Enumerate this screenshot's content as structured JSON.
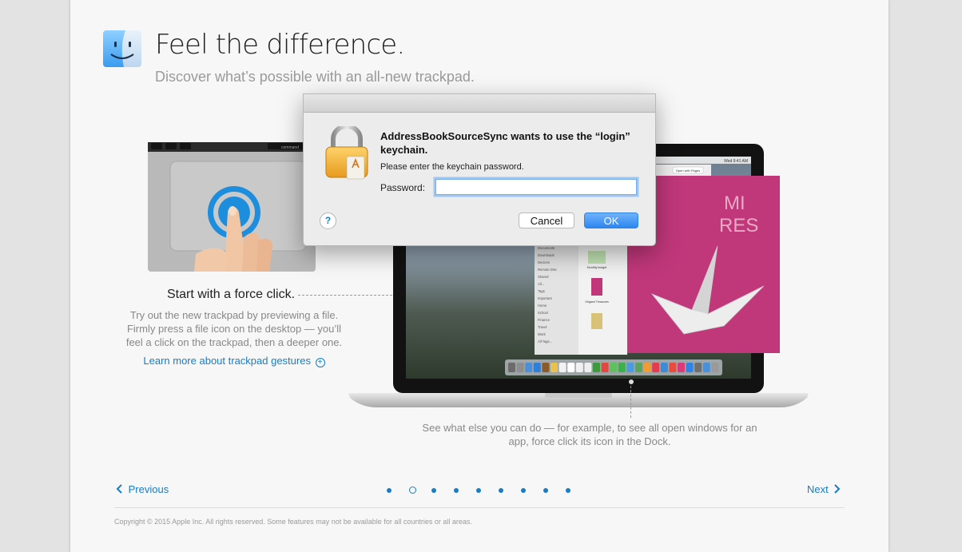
{
  "header": {
    "title": "Feel the difference.",
    "subtitle": "Discover what’s possible with an all-new trackpad.",
    "icon": "finder-icon"
  },
  "force_click": {
    "heading": "Start with a force click.",
    "description": "Try out the new trackpad by previewing a file. Firmly press a file icon on the desktop — you’ll feel a click on the trackpad, then a deeper one.",
    "link_label": "Learn more about trackpad gestures",
    "keyboard_key_label": "command"
  },
  "macbook": {
    "caption": "See what else you can do — for example, to see all open windows for an app, force click its icon in the Dock.",
    "screen": {
      "menu_time": "Wed 9:41 AM",
      "preview_button": "Open with Pages",
      "book_text_1": "MI",
      "book_text_2": "RES",
      "finder_sidebar": [
        "Documents",
        "Downloads",
        "Devices",
        "Remote Disc",
        "Shared",
        "All...",
        "Tags",
        "Important",
        "Home",
        "School",
        "Finance",
        "Travel",
        "Work",
        "All Tags..."
      ],
      "file_labels": [
        "Monthly budget",
        "Origami Treasures"
      ]
    }
  },
  "navigation": {
    "previous_label": "Previous",
    "next_label": "Next",
    "page_count": 9,
    "current_page": 2
  },
  "footer": {
    "copyright": "Copyright © 2015 Apple Inc. All rights reserved. Some features may not be available for all countries or all areas."
  },
  "dialog": {
    "title": "AddressBookSourceSync wants to use the “login” keychain.",
    "message": "Please enter the keychain password.",
    "password_label": "Password:",
    "password_value": "",
    "help_label": "?",
    "cancel_label": "Cancel",
    "ok_label": "OK",
    "icon": "lock-icon"
  },
  "colors": {
    "accent": "#1a7cc1",
    "ok_button": "#2c86f0",
    "book_cover": "#c0377a"
  }
}
